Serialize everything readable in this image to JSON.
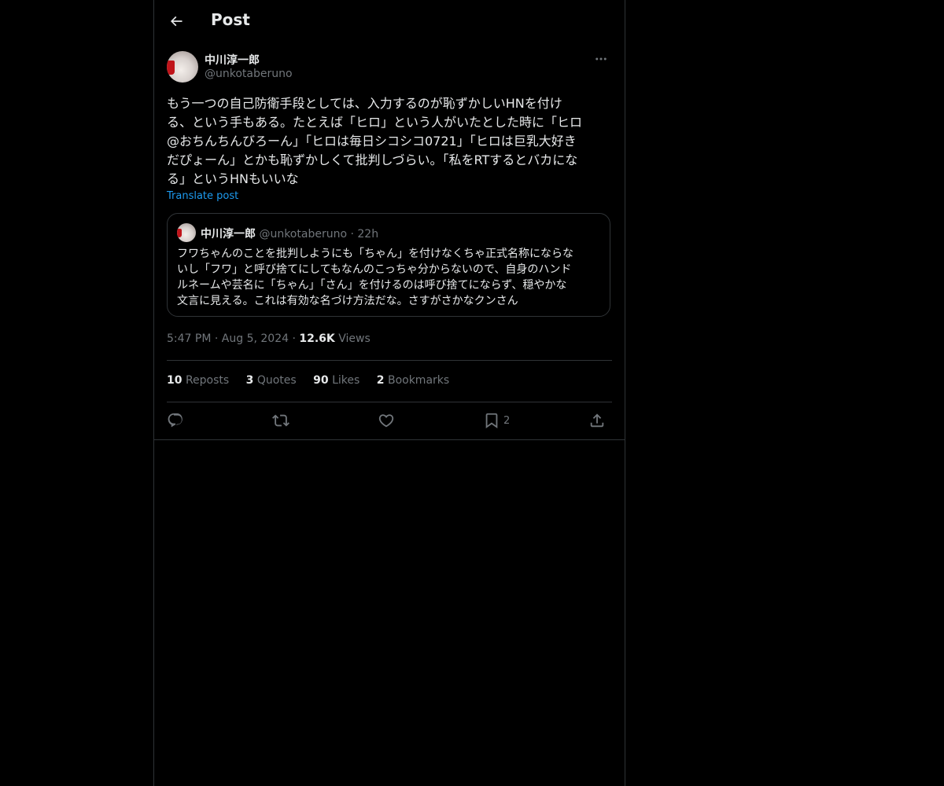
{
  "header": {
    "title": "Post"
  },
  "post": {
    "author_name": "中川淳一郎",
    "author_handle": "@unkotaberuno",
    "text": "もう一つの自己防衛手段としては、入力するのが恥ずかしいHNを付け\nる、という手もある。たとえば「ヒロ」という人がいたとした時に「ヒロ\n@おちんちんびろーん」「ヒロは毎日シコシコ0721」「ヒロは巨乳大好き\nだぴょーん」とかも恥ずかしくて批判しづらい。「私をRTするとバカにな\nる」というHNもいいな",
    "translate_label": "Translate post",
    "time": "5:47 PM",
    "date": "Aug 5, 2024",
    "views_count": "12.6K",
    "views_label": "Views"
  },
  "quote": {
    "author_name": "中川淳一郎",
    "author_handle": "@unkotaberuno",
    "time": "22h",
    "text": "フワちゃんのことを批判しようにも「ちゃん」を付けなくちゃ正式名称にならな\nいし「フワ」と呼び捨てにしてもなんのこっちゃ分からないので、自身のハンド\nルネームや芸名に「ちゃん」「さん」を付けるのは呼び捨てにならず、穏やかな\n文言に見える。これは有効な名づけ方法だな。さすがさかなクンさん"
  },
  "stats": {
    "reposts_count": "10",
    "reposts_label": "Reposts",
    "quotes_count": "3",
    "quotes_label": "Quotes",
    "likes_count": "90",
    "likes_label": "Likes",
    "bookmarks_count": "2",
    "bookmarks_label": "Bookmarks"
  },
  "actions": {
    "bookmark_count": "2"
  },
  "icons": {
    "back": "arrow-left-icon",
    "more": "more-horizontal-icon",
    "reply": "reply-icon",
    "repost": "repost-icon",
    "like": "heart-icon",
    "bookmark": "bookmark-icon",
    "share": "share-icon"
  },
  "colors": {
    "background": "#000000",
    "text": "#e7e9ea",
    "secondary": "#71767b",
    "link": "#1d9bf0",
    "border": "#2f3336"
  }
}
